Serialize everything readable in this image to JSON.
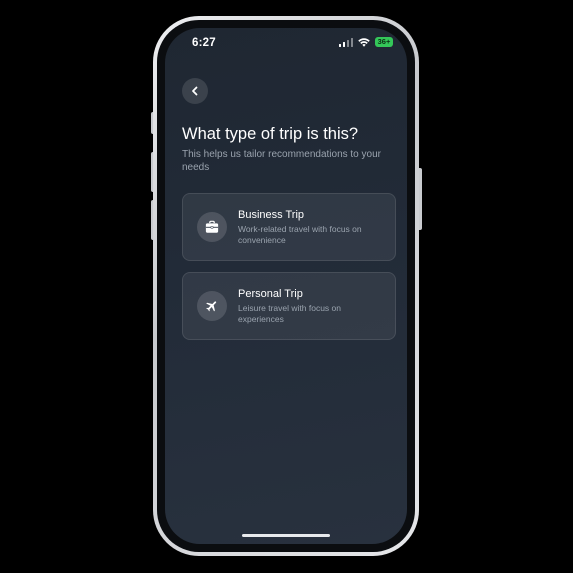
{
  "status_bar": {
    "time": "6:27",
    "battery_label": "36+",
    "signal_icon": "cellular-signal-icon",
    "wifi_icon": "wifi-icon",
    "battery_icon": "battery-icon"
  },
  "nav": {
    "back_icon": "chevron-left-icon"
  },
  "header": {
    "title": "What type of trip is this?",
    "subtitle": "This helps us tailor recommendations to your needs"
  },
  "options": [
    {
      "title": "Business Trip",
      "description": "Work-related travel with focus on convenience",
      "icon": "briefcase-icon"
    },
    {
      "title": "Personal Trip",
      "description": "Leisure travel with focus on experiences",
      "icon": "airplane-icon"
    }
  ],
  "colors": {
    "screen_background": "#222b38",
    "card_background": "#2d3541",
    "text_primary": "#ffffff",
    "text_secondary": "#9aa3ae",
    "battery_fill": "#34c759"
  }
}
